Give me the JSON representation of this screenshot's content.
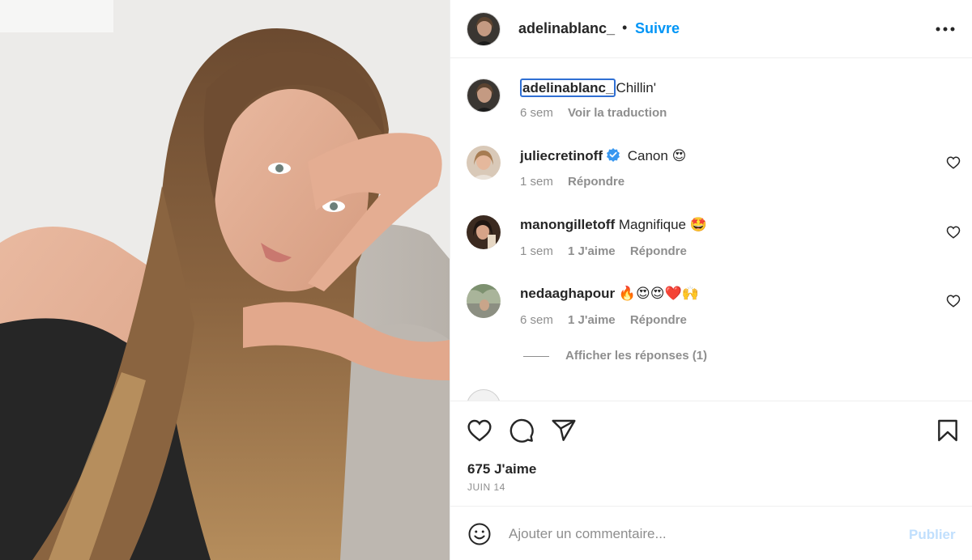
{
  "post": {
    "author": "adelinablanc_",
    "follow_label": "Suivre",
    "separator": "•",
    "more_icon": "more-horizontal-icon"
  },
  "caption": {
    "username": "adelinablanc_",
    "text": "Chillin'",
    "time": "6 sem",
    "translate_label": "Voir la traduction"
  },
  "comments": [
    {
      "username": "juliecretinoff",
      "verified": true,
      "text": "Canon 😍",
      "time": "1 sem",
      "likes": "",
      "reply_label": "Répondre"
    },
    {
      "username": "manongilletoff",
      "verified": false,
      "text": "Magnifique 🤩",
      "time": "1 sem",
      "likes": "1 J'aime",
      "reply_label": "Répondre"
    },
    {
      "username": "nedaaghapour",
      "verified": false,
      "text": "🔥😍😍❤️🙌",
      "time": "6 sem",
      "likes": "1 J'aime",
      "reply_label": "Répondre"
    }
  ],
  "view_replies_label": "Afficher les réponses (1)",
  "actions": {
    "like_icon": "heart-icon",
    "comment_icon": "comment-icon",
    "share_icon": "send-icon",
    "save_icon": "bookmark-icon"
  },
  "likes_count": "675 J'aime",
  "date": "JUIN 14",
  "composer": {
    "placeholder": "Ajouter un commentaire...",
    "publish_label": "Publier",
    "emoji_icon": "smiley-icon"
  },
  "colors": {
    "link_blue": "#0095f6",
    "publish_disabled": "#c0dffd",
    "secondary_text": "#8e8e8e",
    "verified_blue": "#3897f0"
  }
}
